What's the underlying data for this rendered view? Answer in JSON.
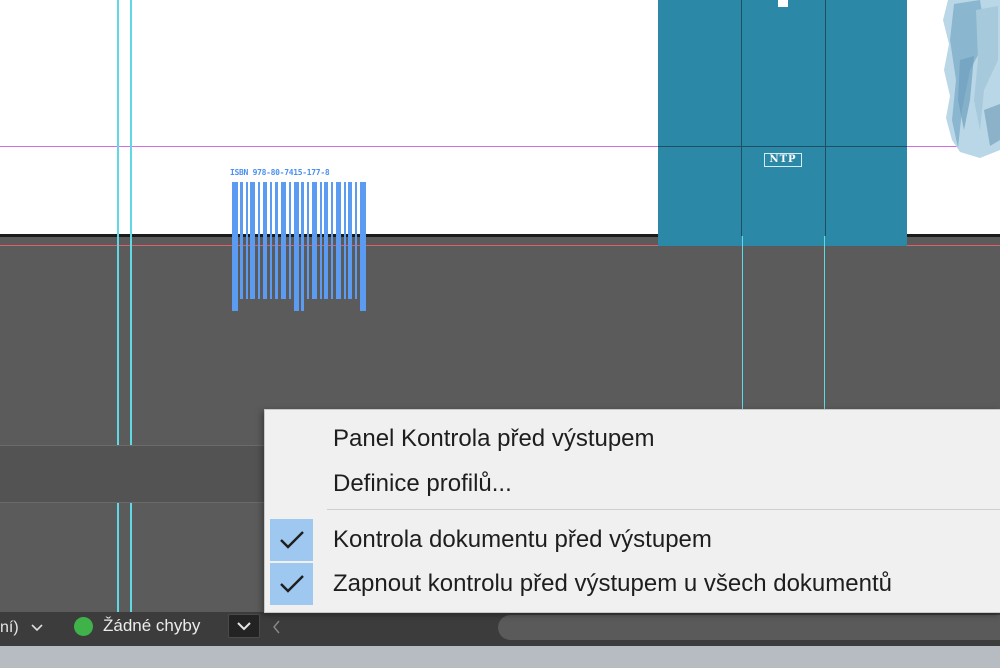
{
  "status_bar": {
    "zoom_fragment": "ní)",
    "preflight_status": "Žádné chyby",
    "status_color": "#3fb34a"
  },
  "barcode": {
    "caption": "ISBN 978-80-7415-177-8"
  },
  "cover": {
    "spine_publisher_mark": "NTP",
    "cover_color": "#2b88a6"
  },
  "preflight_menu": {
    "items": [
      {
        "label": "Panel Kontrola před výstupem",
        "checked": false
      },
      {
        "label": "Definice profilů...",
        "checked": false
      },
      {
        "label": "Kontrola dokumentu před výstupem",
        "checked": true
      },
      {
        "label": "Zapnout kontrolu před výstupem u všech dokumentů",
        "checked": true
      }
    ]
  },
  "icons": {
    "zoom_dropdown": "chevron-down-icon",
    "preflight_menu": "chevron-down-icon",
    "scroll_left": "chevron-left-icon",
    "check": "check-icon"
  }
}
